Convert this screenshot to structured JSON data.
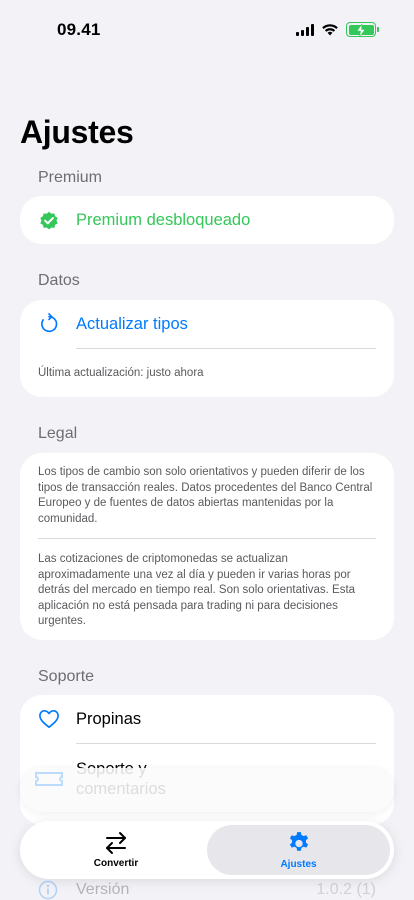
{
  "status_bar": {
    "time": "09.41"
  },
  "page": {
    "title": "Ajustes"
  },
  "premium": {
    "header": "Premium",
    "row_label": "Premium desbloqueado",
    "accent_color": "#34c759"
  },
  "datos": {
    "header": "Datos",
    "refresh_label": "Actualizar tipos",
    "last_update": "Última actualización: justo ahora",
    "accent_color": "#007aff"
  },
  "legal": {
    "header": "Legal",
    "paragraph_1": "Los tipos de cambio son solo orientativos y pueden diferir de los tipos de transacción reales. Datos procedentes del Banco Central Europeo y de fuentes de datos abiertas mantenidas por la comunidad.",
    "paragraph_2": "Las cotizaciones de criptomonedas se actualizan aproximadamente una vez al día y pueden ir varias horas por detrás del mercado en tiempo real. Son solo orientativas. Esta aplicación no está pensada para trading ni para decisiones urgentes."
  },
  "soporte": {
    "header": "Soporte",
    "tips_label": "Propinas",
    "support_label_line1": "Soporte y",
    "support_label_line2": "comentarios"
  },
  "about": {
    "version_label": "Versión",
    "version_value": "1.0.2 (1)"
  },
  "tab_bar": {
    "tabs": [
      {
        "label": "Convertir",
        "icon": "arrows-swap-icon",
        "active": false
      },
      {
        "label": "Ajustes",
        "icon": "gear-icon",
        "active": true
      }
    ],
    "active_color": "#007aff"
  }
}
